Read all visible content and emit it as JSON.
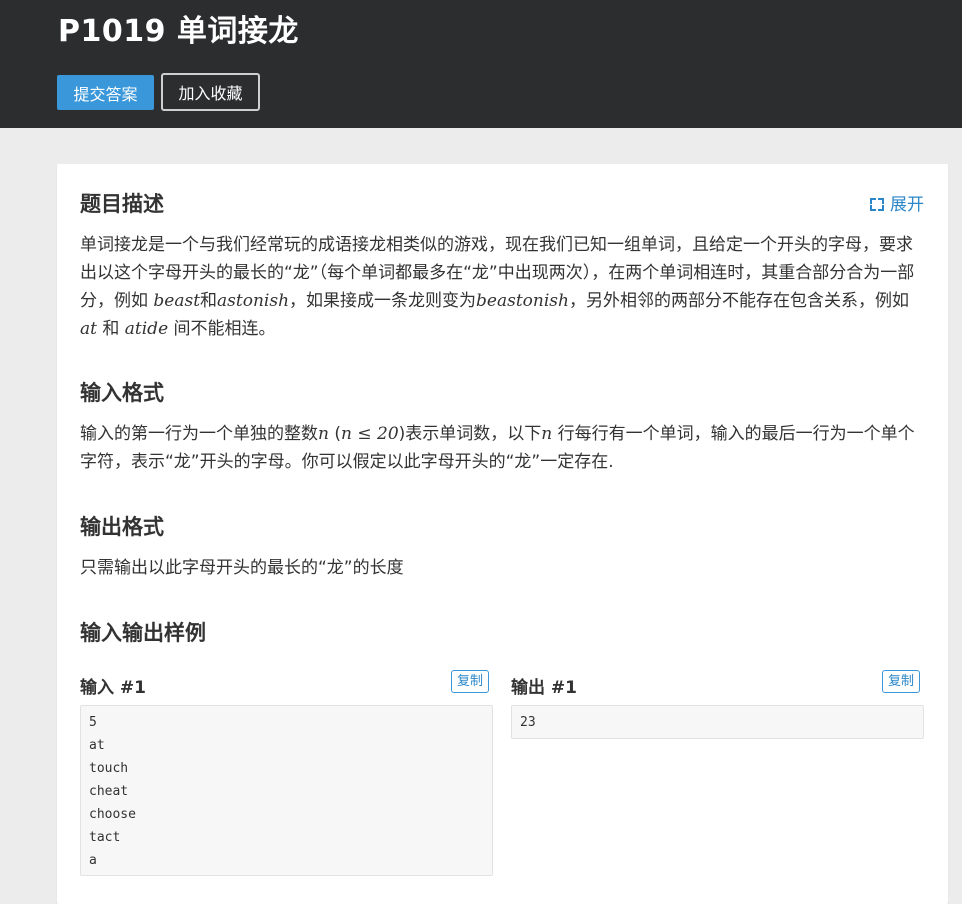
{
  "header": {
    "title": "P1019 单词接龙",
    "submit_label": "提交答案",
    "favorite_label": "加入收藏"
  },
  "sections": {
    "description": {
      "title": "题目描述",
      "expand_label": "展开",
      "p1": "单词接龙是一个与我们经常玩的成语接龙相类似的游戏，现在我们已知一组单词，且给定一个开头的字母，要求出以这个字母开头的最长的“龙”（每个单词都最多在“龙”中出现两次），在两个单词相连时，其重合部分合为一部分，例如 ",
      "w1": "beast",
      "and": "和",
      "w2": "astonish",
      "p2": "，如果接成一条龙则变为",
      "w3": "beastonish",
      "p3": "，另外相邻的两部分不能存在包含关系，例如",
      "w4": "at",
      "p4": " 和 ",
      "w5": "atide",
      "p5": " 间不能相连。"
    },
    "input_format": {
      "title": "输入格式",
      "t1": "输入的第一行为一个单独的整数",
      "n1": "n",
      "t2": " (",
      "cond": "n ≤ 20",
      "t3": ")表示单词数，以下",
      "n2": "n",
      "t4": " 行每行有一个单词，输入的最后一行为一个单个字符，表示“龙”开头的字母。你可以假定以此字母开头的“龙”一定存在."
    },
    "output_format": {
      "title": "输出格式",
      "text": "只需输出以此字母开头的最长的“龙”的长度"
    },
    "samples": {
      "title": "输入输出样例",
      "input_label": "输入 #1",
      "output_label": "输出 #1",
      "copy_label": "复制",
      "input_lines": [
        "5",
        "at",
        "touch",
        "cheat",
        "choose",
        "tact",
        "a"
      ],
      "output_lines": [
        "23"
      ]
    }
  },
  "colors": {
    "header_bg": "#2c2d2f",
    "primary": "#3a97d9",
    "link": "#2b87c9",
    "page_bg": "#ececec"
  }
}
